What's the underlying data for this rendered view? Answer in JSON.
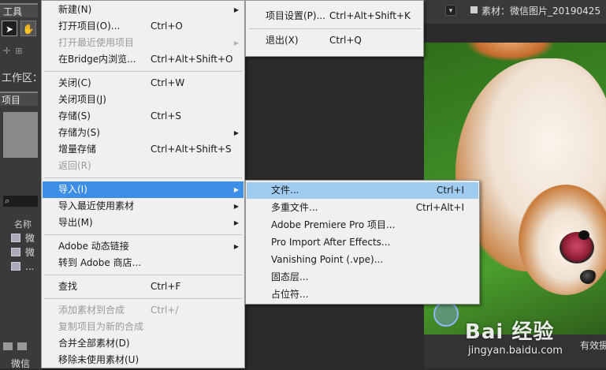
{
  "app": {
    "tools_tab": "工具",
    "workspace_label": "工作区：",
    "project_tab": "项目",
    "search_icon_glyph": "⌕",
    "name_column": "名称",
    "assets": [
      "微",
      "微",
      "..."
    ],
    "bottom_item": "微信",
    "footage_tab": "素材：微信图片_20190425",
    "right_bottom_text": "有效摄"
  },
  "file_menu": {
    "items": [
      {
        "label": "新建(N)",
        "shortcut": "",
        "submenu": true,
        "disabled": false,
        "highlight": false
      },
      {
        "label": "打开项目(O)...",
        "shortcut": "Ctrl+O",
        "submenu": false,
        "disabled": false,
        "highlight": false
      },
      {
        "label": "打开最近使用项目",
        "shortcut": "",
        "submenu": true,
        "disabled": true,
        "highlight": false
      },
      {
        "label": "在Bridge内浏览...",
        "shortcut": "Ctrl+Alt+Shift+O",
        "submenu": false,
        "disabled": false,
        "highlight": false
      },
      {
        "label": "关闭(C)",
        "shortcut": "Ctrl+W",
        "submenu": false,
        "disabled": false,
        "highlight": false
      },
      {
        "label": "关闭项目(J)",
        "shortcut": "",
        "submenu": false,
        "disabled": false,
        "highlight": false
      },
      {
        "label": "存储(S)",
        "shortcut": "Ctrl+S",
        "submenu": false,
        "disabled": false,
        "highlight": false
      },
      {
        "label": "存储为(S)",
        "shortcut": "",
        "submenu": true,
        "disabled": false,
        "highlight": false
      },
      {
        "label": "增量存储",
        "shortcut": "Ctrl+Alt+Shift+S",
        "submenu": false,
        "disabled": false,
        "highlight": false
      },
      {
        "label": "返回(R)",
        "shortcut": "",
        "submenu": false,
        "disabled": true,
        "highlight": false
      },
      {
        "label": "导入(I)",
        "shortcut": "",
        "submenu": true,
        "disabled": false,
        "highlight": true
      },
      {
        "label": "导入最近使用素材",
        "shortcut": "",
        "submenu": true,
        "disabled": false,
        "highlight": false
      },
      {
        "label": "导出(M)",
        "shortcut": "",
        "submenu": true,
        "disabled": false,
        "highlight": false
      },
      {
        "label": "Adobe 动态链接",
        "shortcut": "",
        "submenu": true,
        "disabled": false,
        "highlight": false
      },
      {
        "label": "转到 Adobe 商店...",
        "shortcut": "",
        "submenu": false,
        "disabled": false,
        "highlight": false
      },
      {
        "label": "查找",
        "shortcut": "Ctrl+F",
        "submenu": false,
        "disabled": false,
        "highlight": false
      },
      {
        "label": "添加素材到合成",
        "shortcut": "Ctrl+/",
        "submenu": false,
        "disabled": true,
        "highlight": false
      },
      {
        "label": "复制项目为新的合成",
        "shortcut": "",
        "submenu": false,
        "disabled": true,
        "highlight": false
      },
      {
        "label": "合并全部素材(D)",
        "shortcut": "",
        "submenu": false,
        "disabled": false,
        "highlight": false
      },
      {
        "label": "移除未使用素材(U)",
        "shortcut": "",
        "submenu": false,
        "disabled": false,
        "highlight": false
      }
    ]
  },
  "project_menu": {
    "items": [
      {
        "label": "项目设置(P)...",
        "shortcut": "Ctrl+Alt+Shift+K"
      },
      {
        "label": "退出(X)",
        "shortcut": "Ctrl+Q"
      }
    ]
  },
  "import_menu": {
    "items": [
      {
        "label": "文件...",
        "shortcut": "Ctrl+I",
        "highlight": true
      },
      {
        "label": "多重文件...",
        "shortcut": "Ctrl+Alt+I",
        "highlight": false
      },
      {
        "label": "Adobe Premiere Pro 项目...",
        "shortcut": "",
        "highlight": false
      },
      {
        "label": "Pro Import After Effects...",
        "shortcut": "",
        "highlight": false
      },
      {
        "label": "Vanishing Point (.vpe)...",
        "shortcut": "",
        "highlight": false
      },
      {
        "label": "固态层...",
        "shortcut": "",
        "highlight": false
      },
      {
        "label": "占位符...",
        "shortcut": "",
        "highlight": false
      }
    ]
  },
  "watermark": {
    "main": "Bai 经验",
    "sub": "jingyan.baidu.com"
  },
  "colors": {
    "menu_bg": "#f0f0f0",
    "highlight_blue": "#3d8ee6",
    "highlight_light": "#9fcbf0"
  }
}
